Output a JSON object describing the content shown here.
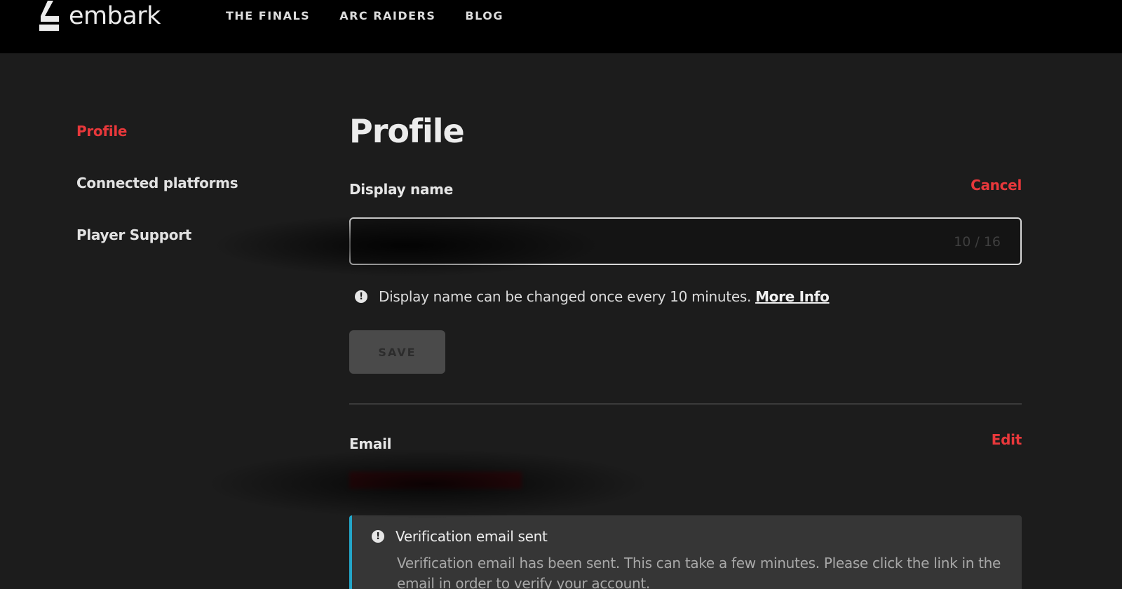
{
  "brand": {
    "name": "embark"
  },
  "nav": {
    "items": [
      {
        "label": "THE FINALS"
      },
      {
        "label": "ARC RAIDERS"
      },
      {
        "label": "BLOG"
      }
    ]
  },
  "sidebar": {
    "items": [
      {
        "label": "Profile",
        "active": true
      },
      {
        "label": "Connected platforms",
        "active": false
      },
      {
        "label": "Player Support",
        "active": false
      }
    ]
  },
  "main": {
    "title": "Profile",
    "display_name": {
      "label": "Display name",
      "cancel_label": "Cancel",
      "input_value": "",
      "counter": "10 / 16",
      "hint_text": "Display name can be changed once every 10 minutes.",
      "hint_link": "More Info",
      "save_label": "SAVE"
    },
    "email": {
      "label": "Email",
      "edit_label": "Edit"
    },
    "notice": {
      "title": "Verification email sent",
      "body": "Verification email has been sent. This can take a few minutes. Please click the link in the email in order to verify your account."
    }
  },
  "colors": {
    "accent": "#e8383b",
    "notice_border": "#23a6c9",
    "background": "#1c1c1c",
    "topbar": "#000000"
  }
}
